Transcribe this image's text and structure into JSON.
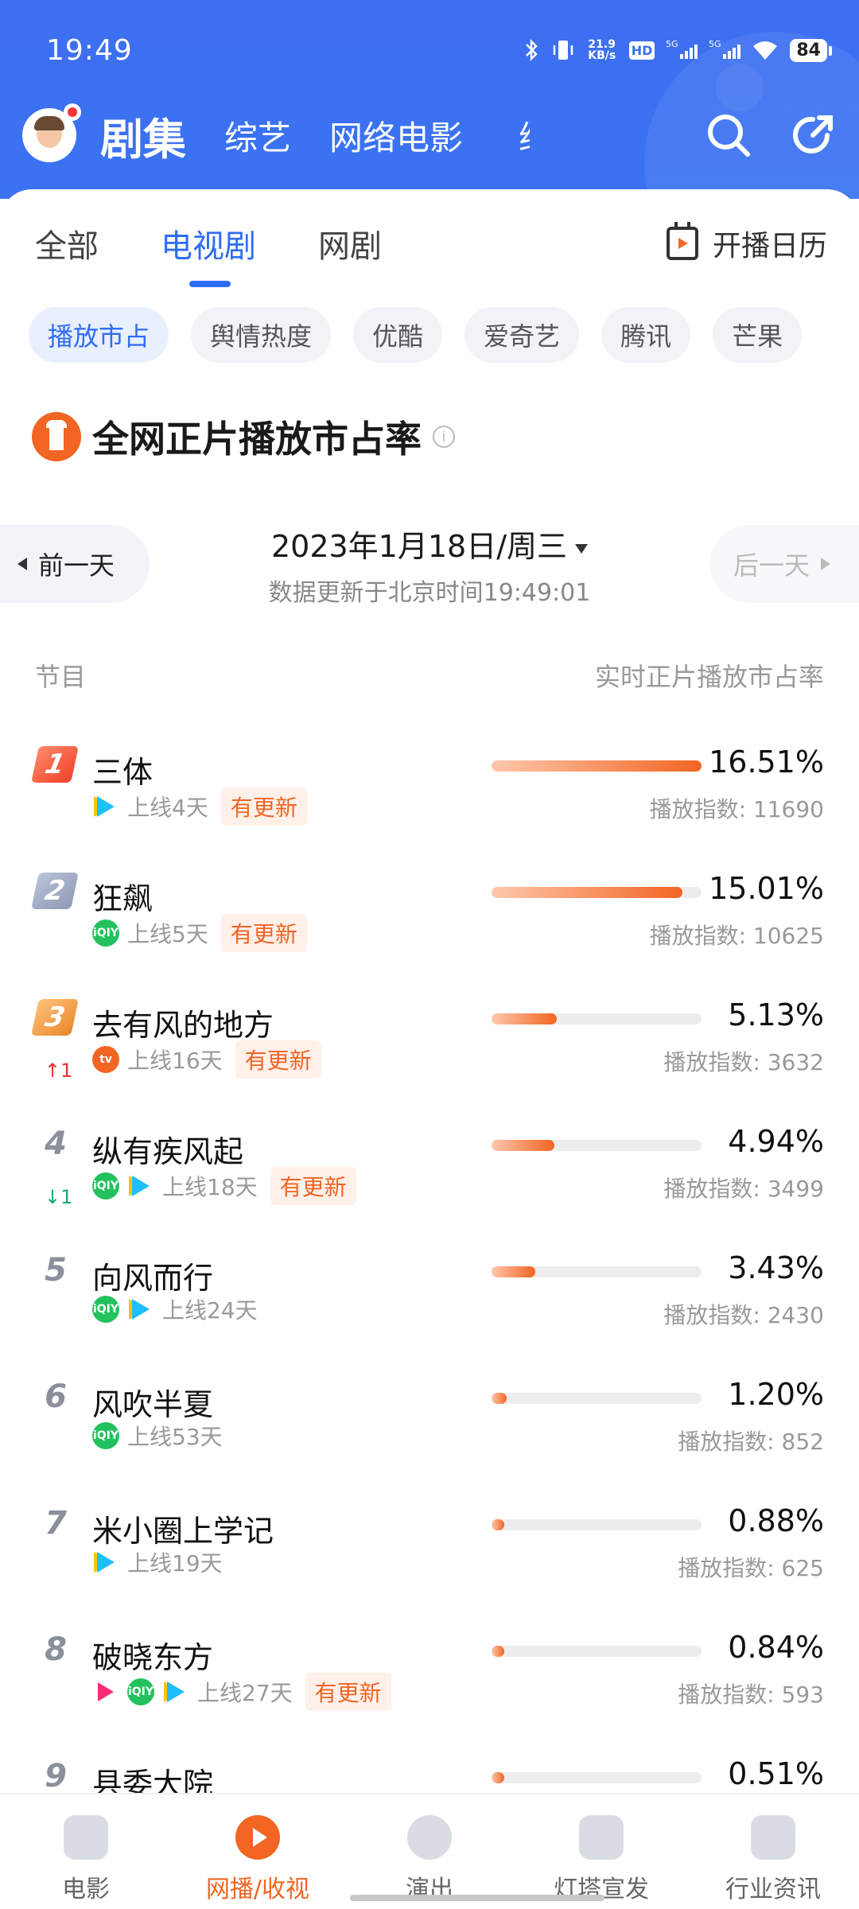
{
  "status_bar": {
    "time": "19:49",
    "net_speed": "21.9 KB/s",
    "battery": "84"
  },
  "top_nav": {
    "tabs": [
      "剧集",
      "综艺",
      "网络电影",
      "综"
    ]
  },
  "sub_tabs": {
    "items": [
      "全部",
      "电视剧",
      "网剧"
    ],
    "active": 1,
    "calendar_label": "开播日历"
  },
  "chips": {
    "items": [
      "播放市占",
      "舆情热度",
      "优酷",
      "爱奇艺",
      "腾讯",
      "芒果"
    ],
    "active": 0
  },
  "section": {
    "title": "全网正片播放市占率"
  },
  "date_nav": {
    "prev": "前一天",
    "date": "2023年1月18日/周三",
    "updated": "数据更新于北京时间19:49:01",
    "next": "后一天"
  },
  "columns": {
    "left": "节目",
    "right": "实时正片播放市占率"
  },
  "rows": [
    {
      "rank": "1",
      "title": "三体",
      "platforms": [
        "tx"
      ],
      "days": "上线4天",
      "update": "有更新",
      "trend": "",
      "pct": "16.51%",
      "share": 0.1651,
      "index": "播放指数: 11690"
    },
    {
      "rank": "2",
      "title": "狂飙",
      "platforms": [
        "qy"
      ],
      "days": "上线5天",
      "update": "有更新",
      "trend": "",
      "pct": "15.01%",
      "share": 0.1501,
      "index": "播放指数: 10625"
    },
    {
      "rank": "3",
      "title": "去有风的地方",
      "platforms": [
        "mg"
      ],
      "days": "上线16天",
      "update": "有更新",
      "trend": "↑1",
      "pct": "5.13%",
      "share": 0.0513,
      "index": "播放指数: 3632"
    },
    {
      "rank": "4",
      "title": "纵有疾风起",
      "platforms": [
        "qy",
        "tx"
      ],
      "days": "上线18天",
      "update": "有更新",
      "trend": "↓1",
      "pct": "4.94%",
      "share": 0.0494,
      "index": "播放指数: 3499"
    },
    {
      "rank": "5",
      "title": "向风而行",
      "platforms": [
        "qy",
        "tx"
      ],
      "days": "上线24天",
      "update": "",
      "trend": "",
      "pct": "3.43%",
      "share": 0.0343,
      "index": "播放指数: 2430"
    },
    {
      "rank": "6",
      "title": "风吹半夏",
      "platforms": [
        "qy"
      ],
      "days": "上线53天",
      "update": "",
      "trend": "",
      "pct": "1.20%",
      "share": 0.012,
      "index": "播放指数: 852"
    },
    {
      "rank": "7",
      "title": "米小圈上学记",
      "platforms": [
        "tx"
      ],
      "days": "上线19天",
      "update": "",
      "trend": "",
      "pct": "0.88%",
      "share": 0.0088,
      "index": "播放指数: 625"
    },
    {
      "rank": "8",
      "title": "破晓东方",
      "platforms": [
        "yk",
        "qy",
        "tx"
      ],
      "days": "上线27天",
      "update": "有更新",
      "trend": "",
      "pct": "0.84%",
      "share": 0.0084,
      "index": "播放指数: 593"
    },
    {
      "rank": "9",
      "title": "县委大院",
      "platforms": [],
      "days": "",
      "update": "",
      "trend": "",
      "pct": "0.51%",
      "share": 0.0051,
      "index": ""
    }
  ],
  "bottom_nav": {
    "items": [
      "电影",
      "网播/收视",
      "演出",
      "灯塔宣发",
      "行业资讯"
    ],
    "active": 1
  },
  "colors": {
    "brand_blue": "#3a73f2",
    "accent_orange": "#f26522"
  }
}
